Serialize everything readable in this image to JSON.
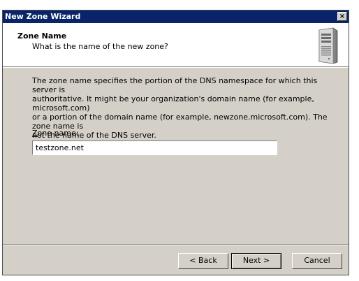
{
  "window": {
    "title": "New Zone Wizard",
    "close_label": "×"
  },
  "header": {
    "title": "Zone Name",
    "subtitle": "What is the name of the new zone?",
    "icon": "server-icon"
  },
  "description": {
    "line1": "The zone name specifies the portion of the DNS namespace for which this server is",
    "line2": "authoritative. It might be your organization's domain name (for example,  microsoft.com)",
    "line3": "or a portion of the domain name (for example, newzone.microsoft.com). The zone name is",
    "line4": "not the name of the DNS server."
  },
  "form": {
    "label_prefix": "Z",
    "label_rest": "one name:",
    "value": "testzone.net"
  },
  "buttons": {
    "back": "< Back",
    "next": "Next >",
    "cancel": "Cancel"
  },
  "colors": {
    "titlebar": "#0a246a",
    "face": "#d4d0c8"
  }
}
